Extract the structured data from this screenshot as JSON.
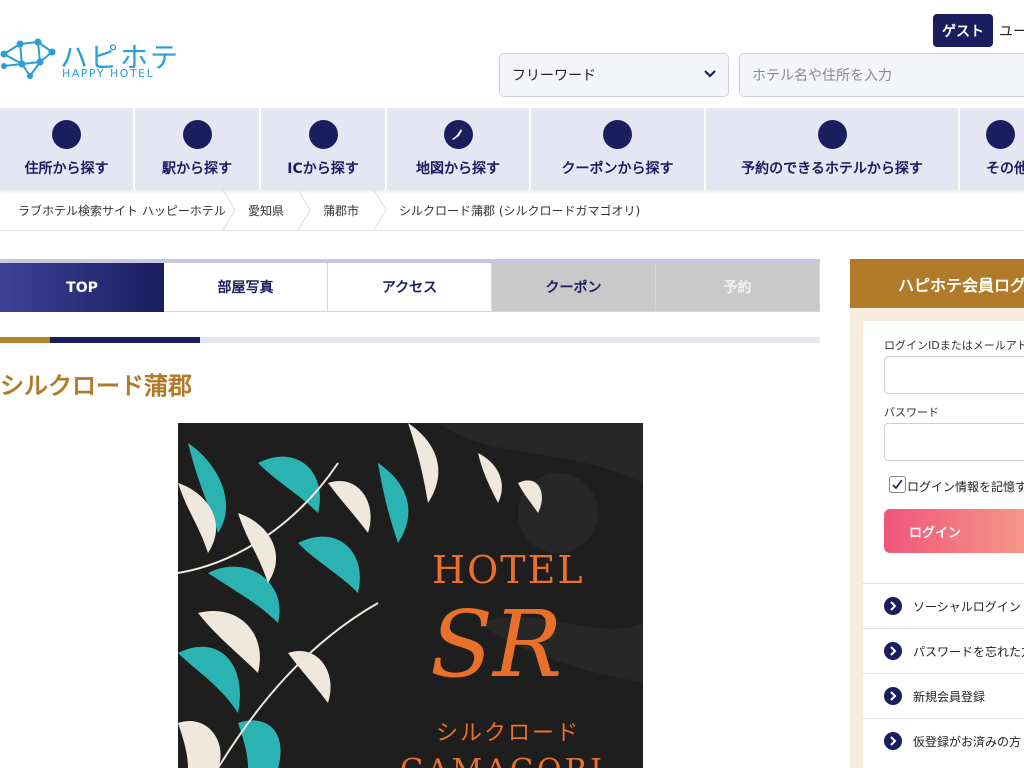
{
  "header": {
    "logo_jp": "ハピホテ",
    "logo_en": "HAPPY HOTEL",
    "guest_label": "ゲスト",
    "user_label": "ユー",
    "select_value": "フリーワード",
    "search_placeholder": "ホテル名や住所を入力"
  },
  "nav": {
    "items": [
      {
        "label": "住所から探す",
        "icon": "pin-icon"
      },
      {
        "label": "駅から探す",
        "icon": "train-icon"
      },
      {
        "label": "ICから探す",
        "icon": "car-icon"
      },
      {
        "label": "地図から探す",
        "icon": "japan-map-icon"
      },
      {
        "label": "クーポンから探す",
        "icon": "coupon-icon"
      },
      {
        "label": "予約のできるホテルから探す",
        "icon": "calendar-icon"
      },
      {
        "label": "その他",
        "icon": "more-icon"
      }
    ]
  },
  "breadcrumb": {
    "items": [
      "ラブホテル検索サイト ハッピーホテル",
      "愛知県",
      "蒲郡市",
      "シルクロード蒲郡 (シルクロードガマゴオリ)"
    ]
  },
  "tabs": {
    "items": [
      "TOP",
      "部屋写真",
      "アクセス",
      "クーポン",
      "予約"
    ]
  },
  "hotel": {
    "title": "シルクロード蒲郡",
    "image_text_hotel": "HOTEL",
    "image_text_sr": "SR",
    "image_text_katakana": "シルクロード",
    "image_text_city": "GAMAGORI"
  },
  "login": {
    "heading": "ハピホテ会員ログ",
    "id_label": "ログインIDまたはメールアドレ",
    "password_label": "パスワード",
    "remember_label": "ログイン情報を記憶す",
    "login_button": "ログイン",
    "links": [
      "ソーシャルログイン",
      "パスワードを忘れた方",
      "新規会員登録",
      "仮登録がお済みの方"
    ]
  },
  "colors": {
    "navy": "#1a1d5e",
    "gold": "#b07a28",
    "nav_bg": "#e4e6f3",
    "logo_blue": "#2a9fd6"
  }
}
